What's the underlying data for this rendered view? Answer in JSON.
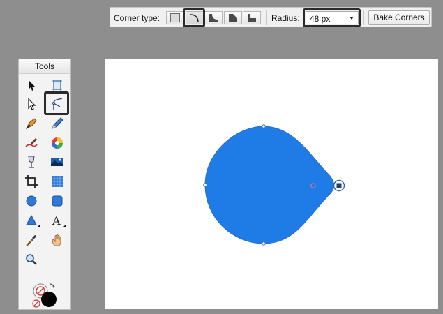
{
  "toolbar": {
    "corner_type_label": "Corner type:",
    "radius_label": "Radius:",
    "radius_value": "48 px",
    "bake_label": "Bake Corners",
    "corner_types": [
      "none",
      "rounded",
      "inverted-rounded",
      "straight",
      "inset"
    ],
    "selected_corner_type": "rounded"
  },
  "tools": {
    "title": "Tools",
    "items": [
      "pointer-tool",
      "artboard-tool",
      "node-tool",
      "corner-tool",
      "pen-tool",
      "pencil-tool",
      "vector-brush-tool",
      "fill-tool",
      "transparency-tool",
      "place-image-tool",
      "crop-tool",
      "image-tool",
      "ellipse-tool",
      "rounded-rectangle-tool",
      "triangle-tool",
      "artistic-text-tool",
      "color-picker-tool",
      "view-tool",
      "zoom-tool"
    ],
    "selected": "corner-tool"
  },
  "shape": {
    "fill": "#1f7be6"
  },
  "colors": {
    "fill": "#ffffff",
    "stroke": "#000000",
    "toolbar_bg": "#f0f0f0",
    "workspace_bg": "#8e8e8e"
  }
}
